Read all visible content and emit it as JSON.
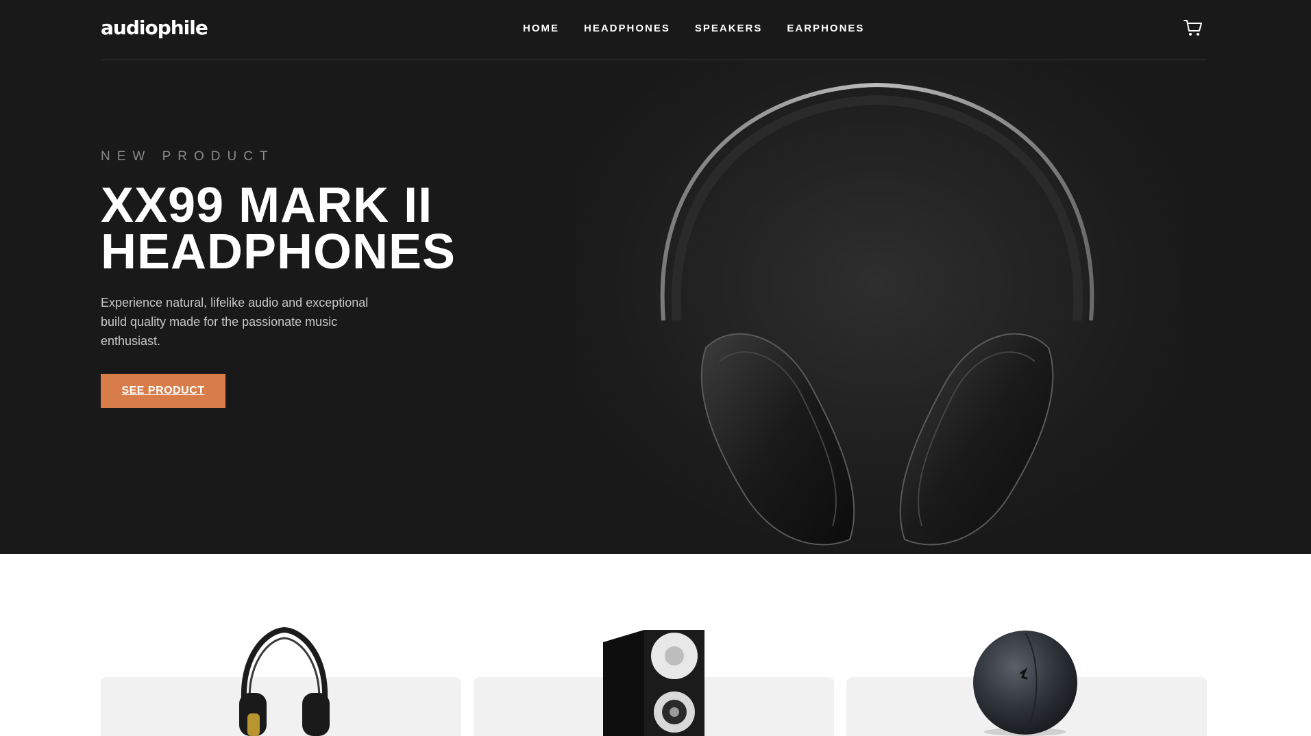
{
  "brand": {
    "logo": "audiophile"
  },
  "nav": {
    "items": [
      {
        "label": "HOME"
      },
      {
        "label": "HEADPHONES"
      },
      {
        "label": "SPEAKERS"
      },
      {
        "label": "EARPHONES"
      }
    ]
  },
  "cart": {
    "icon": "cart-icon"
  },
  "hero": {
    "overline": "NEW PRODUCT",
    "title": "XX99 MARK II HEADPHONES",
    "description": "Experience natural, lifelike audio and exceptional build quality made for the passionate music enthusiast.",
    "cta_label": "SEE PRODUCT"
  },
  "colors": {
    "hero_bg": "#191919",
    "accent": "#D87D4A",
    "card_bg": "#F1F1F1"
  },
  "categories": [
    {
      "icon": "headphones-icon"
    },
    {
      "icon": "speaker-icon"
    },
    {
      "icon": "earphones-icon"
    }
  ]
}
